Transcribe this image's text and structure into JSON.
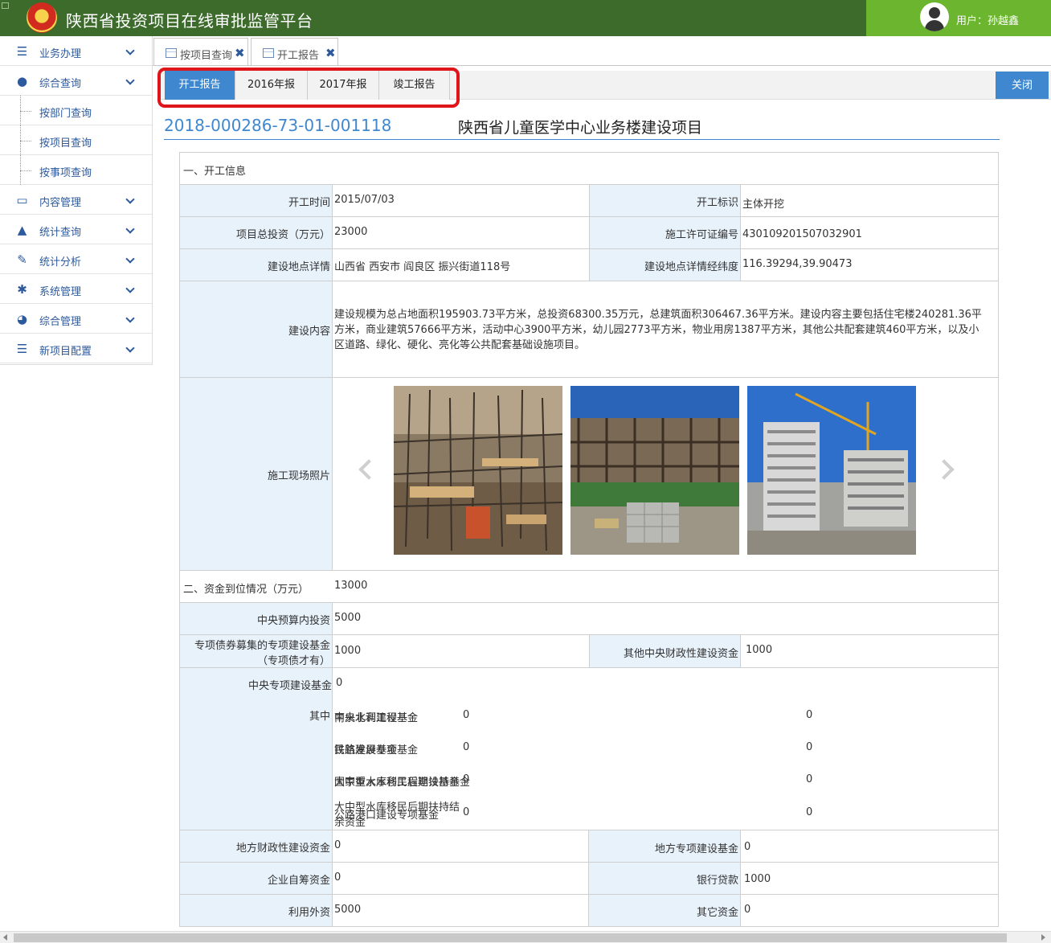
{
  "app": {
    "title": "陕西省投资项目在线审批监管平台",
    "user_label": "用户：孙越鑫"
  },
  "sidebar": {
    "items": [
      {
        "label": "业务办理",
        "icon": "list-icon"
      },
      {
        "label": "综合查询",
        "icon": "user-icon"
      },
      {
        "label": "按部门查询",
        "sub": true
      },
      {
        "label": "按项目查询",
        "sub": true
      },
      {
        "label": "按事项查询",
        "sub": true
      },
      {
        "label": "内容管理",
        "icon": "monitor-icon"
      },
      {
        "label": "统计查询",
        "icon": "bell-icon"
      },
      {
        "label": "统计分析",
        "icon": "edit-icon"
      },
      {
        "label": "系统管理",
        "icon": "gear-icon"
      },
      {
        "label": "综合管理",
        "icon": "dashboard-icon"
      },
      {
        "label": "新项目配置",
        "icon": "list-icon"
      }
    ]
  },
  "tabs": [
    {
      "label": "按项目查询"
    },
    {
      "label": "开工报告"
    }
  ],
  "subtabs": [
    {
      "label": "开工报告",
      "active": true
    },
    {
      "label": "2016年报"
    },
    {
      "label": "2017年报"
    },
    {
      "label": "竣工报告"
    }
  ],
  "close_label": "关闭",
  "project": {
    "code": "2018-000286-73-01-001118",
    "name": "陕西省儿童医学中心业务楼建设项目"
  },
  "section1": {
    "title": "一、开工信息",
    "start_time_label": "开工时间",
    "start_time": "2015/07/03",
    "start_mark_label": "开工标识",
    "start_mark": "主体开挖",
    "total_invest_label": "项目总投资（万元）",
    "total_invest": "23000",
    "permit_label": "施工许可证编号",
    "permit": "430109201507032901",
    "site_label": "建设地点详情",
    "site": "山西省 西安市 阎良区 振兴街道118号",
    "coords_label": "建设地点详情经纬度",
    "coords": "116.39294,39.90473",
    "content_label": "建设内容",
    "content": "建设规模为总占地面积195903.73平方米，总投资68300.35万元，总建筑面积306467.36平方米。建设内容主要包括住宅楼240281.36平方米，商业建筑57666平方米，活动中心3900平方米，幼儿园2773平方米，物业用房1387平方米，其他公共配套建筑460平方米，以及小区道路、绿化、硬化、亮化等公共配套基础设施项目。",
    "photos_label": "施工现场照片"
  },
  "section2": {
    "title": "二、资金到位情况（万元）",
    "total": "13000",
    "central_budget_label": "中央预算内投资",
    "central_budget": "5000",
    "bond_label_1": "专项债券募集的专项建设基金",
    "bond_label_2": "（专项债才有）",
    "bond": "1000",
    "other_central_label": "其他中央财政性建设资金",
    "other_central": "1000",
    "central_special_label": "中央专项建设基金",
    "central_special": "0",
    "among_label": "其中",
    "water_label": "中央水利建设基金",
    "water": "0",
    "south_north_label": "南水北调工程基金",
    "south_north": "0",
    "rail_label": "铁路建设专项基金",
    "rail": "0",
    "aviation_label": "民航发展基金",
    "aviation": "0",
    "major_water_label": "国家重大水利工程建设基金",
    "major_water": "0",
    "reservoir_label": "大中型水库移民后期扶持基金",
    "reservoir": "0",
    "reservoir_rem_label_1": "大中型水库移民后期扶持结",
    "reservoir_rem_label_2": "余资金",
    "reservoir_rem": "0",
    "port_label": "公路港口建设专项基金",
    "port": "0",
    "local_fiscal_label": "地方财政性建设资金",
    "local_fiscal": "0",
    "local_special_label": "地方专项建设基金",
    "local_special": "0",
    "self_label": "企业自筹资金",
    "self": "0",
    "loan_label": "银行贷款",
    "loan": "1000",
    "foreign_label": "利用外资",
    "foreign": "5000",
    "other_label": "其它资金",
    "other": "0"
  }
}
